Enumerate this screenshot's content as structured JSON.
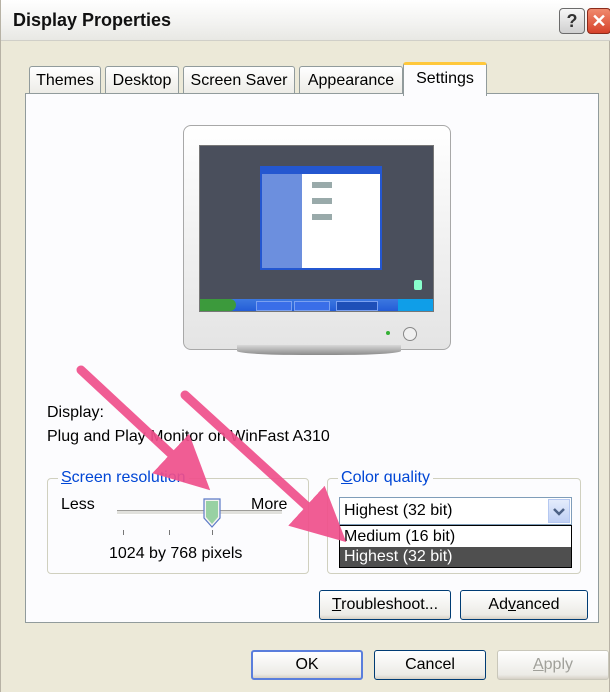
{
  "window": {
    "title": "Display Properties"
  },
  "titlebar": {
    "help_glyph": "?",
    "close_glyph": "✕"
  },
  "tabs": [
    {
      "label": "Themes",
      "active": false
    },
    {
      "label": "Desktop",
      "active": false
    },
    {
      "label": "Screen Saver",
      "active": false
    },
    {
      "label": "Appearance",
      "active": false
    },
    {
      "label": "Settings",
      "active": true
    }
  ],
  "display": {
    "label": "Display:",
    "device": "Plug and Play Monitor on WinFast A310"
  },
  "screen_resolution": {
    "legend_first": "S",
    "legend_rest": "creen resolution",
    "less_label": "Less",
    "more_label": "More",
    "value_text": "1024 by 768 pixels",
    "slider_level": 0.67
  },
  "color_quality": {
    "legend_first": "C",
    "legend_rest": "olor quality",
    "selected": "Highest (32 bit)",
    "options": [
      "Medium (16 bit)",
      "Highest (32 bit)"
    ],
    "highlighted_option": "Highest (32 bit)"
  },
  "buttons": {
    "troubleshoot_first": "T",
    "troubleshoot_rest": "roubleshoot...",
    "advanced_pre": "Ad",
    "advanced_u": "v",
    "advanced_post": "anced",
    "ok": "OK",
    "cancel": "Cancel",
    "apply_first": "A",
    "apply_rest": "pply"
  },
  "colors": {
    "dialog_bg": "#ece9d8",
    "panel_bg": "#fcfcfe",
    "active_tab_accent": "#ffc83c",
    "groupbox_legend": "#0046d5",
    "annotation_arrow": "#f0508c",
    "list_highlight": "#4f4f4f"
  },
  "annotations": [
    {
      "type": "arrow",
      "points_to": "screen-resolution-slider"
    },
    {
      "type": "arrow",
      "points_to": "color-quality-highest-option"
    }
  ]
}
